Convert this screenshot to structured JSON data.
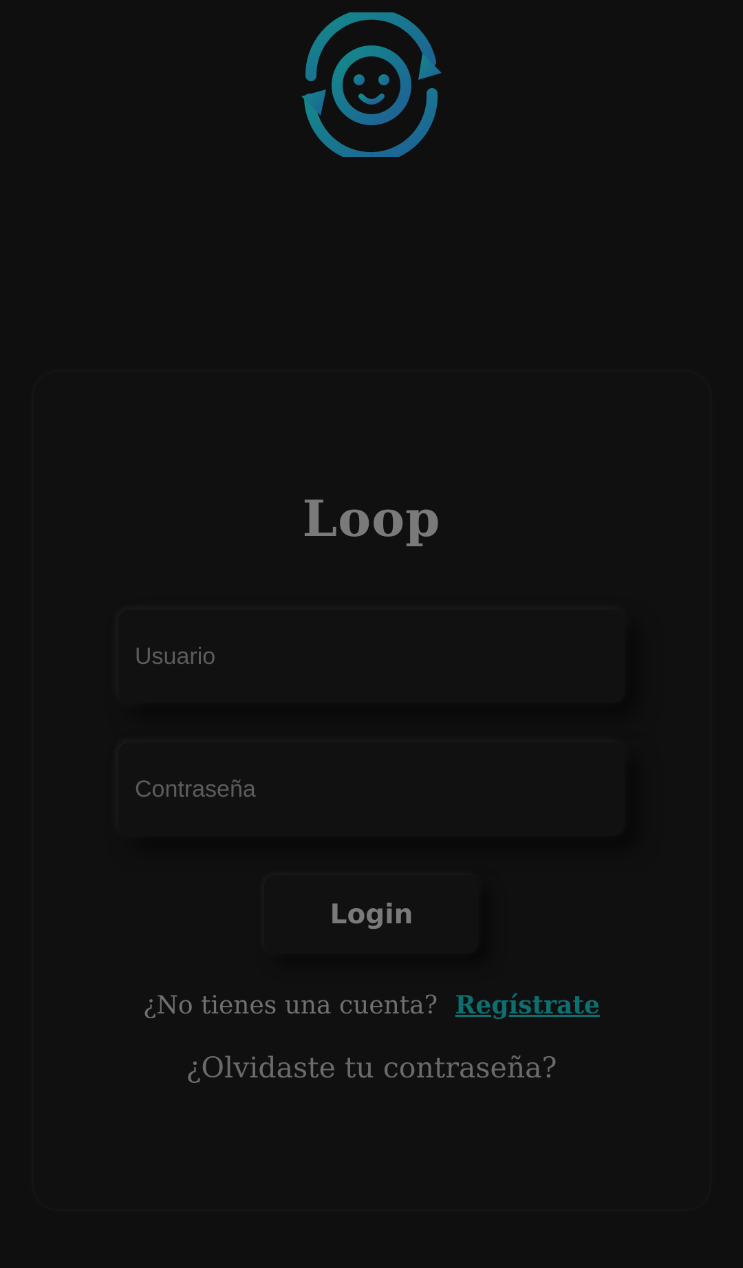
{
  "app": {
    "logo_icon": "loop-smiley-refresh-icon",
    "title": "Loop"
  },
  "form": {
    "username_placeholder": "Usuario",
    "password_placeholder": "Contraseña",
    "login_label": "Login"
  },
  "links": {
    "no_account_text": "¿No tienes una cuenta?",
    "register_label": "Regístrate",
    "forgot_password_label": "¿Olvidaste tu contraseña?"
  },
  "colors": {
    "background": "#0f0f0f",
    "card": "#101010",
    "text_muted": "#7a7a7a",
    "link_accent": "#0d6f6f",
    "logo_gradient_start": "#138a8a",
    "logo_gradient_end": "#1f5f96"
  }
}
